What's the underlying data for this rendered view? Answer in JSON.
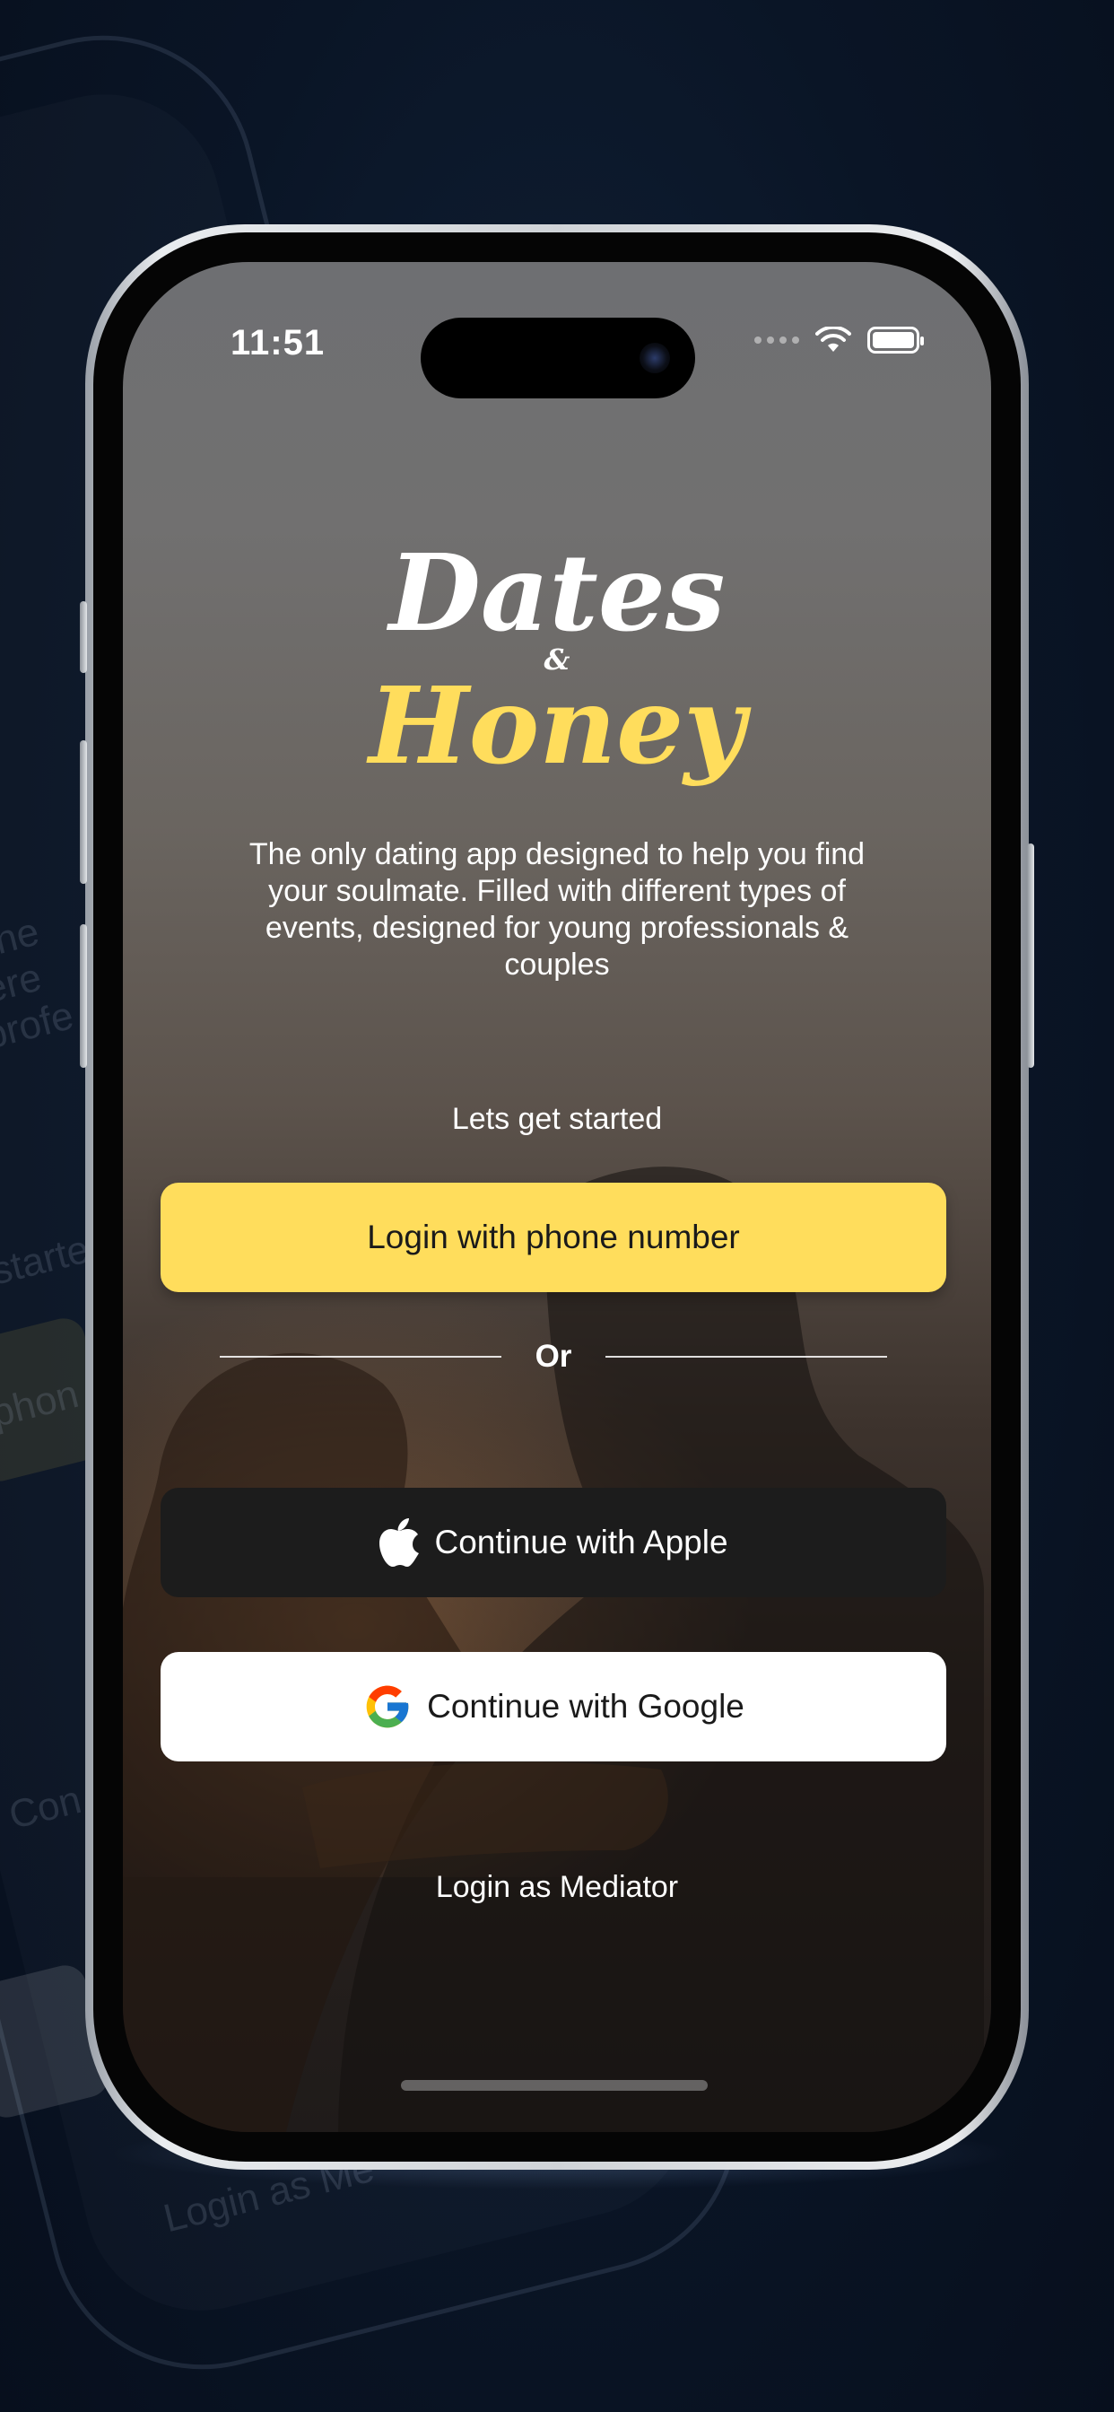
{
  "status_bar": {
    "time": "11:51"
  },
  "app": {
    "logo_word1": "Dates",
    "logo_amp": "&",
    "logo_word2": "Honey",
    "tagline": "The only dating app designed to help you find your soulmate. Filled with different types of events, designed for young professionals & couples",
    "start_label": "Lets get started"
  },
  "buttons": {
    "phone_label": "Login with phone number",
    "or_label": "Or",
    "apple_label": "Continue with Apple",
    "google_label": "Continue with Google",
    "mediator_label": "Login as Mediator"
  },
  "icons": [
    "apple-icon",
    "google-icon",
    "wifi-icon",
    "battery-icon",
    "signal-dots-icon"
  ],
  "colors": {
    "background": "#0a1424",
    "accent_yellow": "#ffdd5c",
    "apple_button": "#1c1c1c",
    "google_button": "#ffffff"
  }
}
